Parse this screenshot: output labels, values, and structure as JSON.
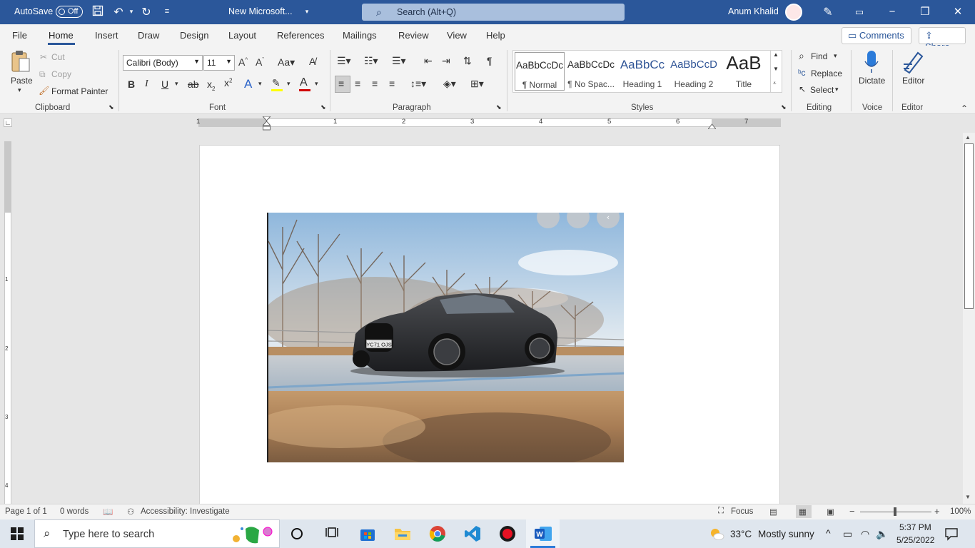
{
  "titlebar": {
    "autosave_label": "AutoSave",
    "autosave_state": "Off",
    "doc_title": "New Microsoft...",
    "search_placeholder": "Search (Alt+Q)",
    "user_name": "Anum Khalid"
  },
  "menu": {
    "tabs": [
      "File",
      "Home",
      "Insert",
      "Draw",
      "Design",
      "Layout",
      "References",
      "Mailings",
      "Review",
      "View",
      "Help"
    ],
    "active_tab": "Home",
    "comments_label": "Comments",
    "share_label": "Share"
  },
  "ribbon": {
    "clipboard": {
      "paste": "Paste",
      "cut": "Cut",
      "copy": "Copy",
      "format_painter": "Format Painter",
      "group": "Clipboard"
    },
    "font": {
      "family": "Calibri (Body)",
      "size": "11",
      "group": "Font"
    },
    "paragraph": {
      "group": "Paragraph"
    },
    "styles": {
      "items": [
        {
          "preview": "AaBbCcDc",
          "name": "¶ Normal"
        },
        {
          "preview": "AaBbCcDc",
          "name": "¶ No Spac..."
        },
        {
          "preview": "AaBbCc",
          "name": "Heading 1"
        },
        {
          "preview": "AaBbCcD",
          "name": "Heading 2"
        },
        {
          "preview": "AaB",
          "name": "Title"
        }
      ],
      "group": "Styles"
    },
    "editing": {
      "find": "Find",
      "replace": "Replace",
      "select": "Select",
      "group": "Editing"
    },
    "voice": {
      "dictate": "Dictate",
      "group": "Voice"
    },
    "editor": {
      "editor": "Editor",
      "group": "Editor"
    }
  },
  "ruler": {
    "numbers": [
      "1",
      "1",
      "2",
      "3",
      "4",
      "5",
      "6",
      "7"
    ],
    "vnumbers": [
      "1",
      "2",
      "3",
      "4"
    ]
  },
  "image": {
    "plate": "YC71 OJS"
  },
  "status": {
    "page": "Page 1 of 1",
    "words": "0 words",
    "accessibility": "Accessibility: Investigate",
    "focus": "Focus",
    "zoom": "100%"
  },
  "taskbar": {
    "search_placeholder": "Type here to search",
    "weather_temp": "33°C",
    "weather_desc": "Mostly sunny",
    "time": "5:37 PM",
    "date": "5/25/2022"
  },
  "colors": {
    "brand": "#2b579a",
    "taskbar": "#dfe6ee"
  }
}
